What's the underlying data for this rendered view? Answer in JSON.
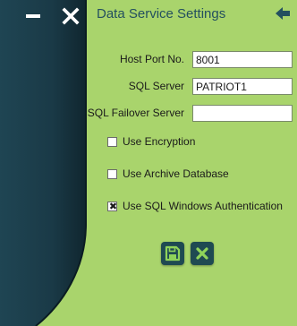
{
  "window": {
    "title": "Data Service Settings",
    "controls": {
      "minimize_icon": "minimize-icon",
      "close_icon": "close-icon",
      "back_icon": "back-arrow-icon"
    }
  },
  "form": {
    "host_port": {
      "label": "Host Port No.",
      "value": "8001"
    },
    "sql_server": {
      "label": "SQL Server",
      "value": "PATRIOT1"
    },
    "sql_failover": {
      "label": "SQL Failover Server",
      "value": ""
    }
  },
  "options": [
    {
      "label": "Use Encryption",
      "checked": false
    },
    {
      "label": "Use Archive Database",
      "checked": false
    },
    {
      "label": "Use SQL Windows Authentication",
      "checked": true
    }
  ],
  "actions": {
    "save_icon": "save-icon",
    "cancel_icon": "cancel-icon"
  },
  "colors": {
    "background": "#a9d46c",
    "dark_panel": "#1b3b48",
    "title_text": "#24505f",
    "button_bg": "#1f4a52",
    "button_icon": "#8fd35a"
  }
}
